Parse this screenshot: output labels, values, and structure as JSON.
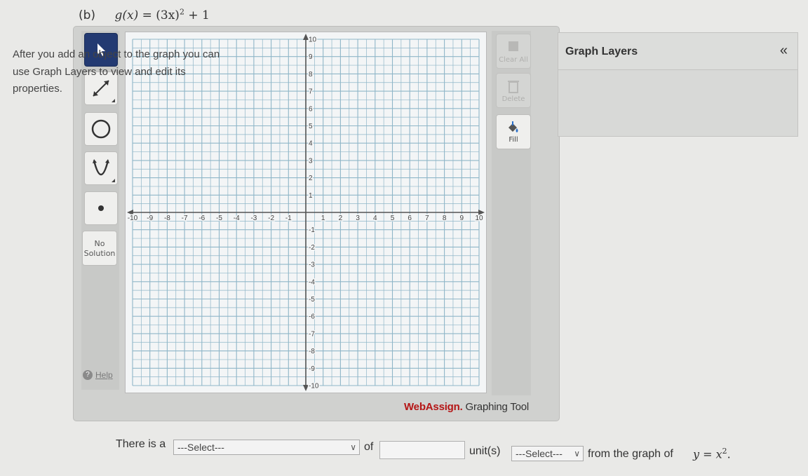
{
  "problem": {
    "part": "(b)",
    "func": "g(x)",
    "eq": "=",
    "base": "(3x)",
    "exp": "2",
    "tail": "+ 1"
  },
  "toolbar": {
    "tools": [
      {
        "name": "select-tool",
        "icon": "arrow-pointer-icon",
        "active": true
      },
      {
        "name": "line-tool",
        "icon": "line-segment-icon"
      },
      {
        "name": "circle-tool",
        "icon": "circle-icon"
      },
      {
        "name": "parabola-tool",
        "icon": "parabola-icon"
      },
      {
        "name": "point-tool",
        "icon": "point-icon"
      }
    ],
    "no_solution_line1": "No",
    "no_solution_line2": "Solution",
    "help_label": "Help"
  },
  "side_tools": {
    "clear_label": "Clear All",
    "delete_label": "Delete",
    "fill_label": "Fill"
  },
  "graph": {
    "x_min": -10,
    "x_max": 10,
    "y_min": -10,
    "y_max": 10,
    "x_ticks": [
      "-10",
      "-9",
      "-8",
      "-7",
      "-6",
      "-5",
      "-4",
      "-3",
      "-2",
      "-1",
      "1",
      "2",
      "3",
      "4",
      "5",
      "6",
      "7",
      "8",
      "9",
      "10"
    ],
    "y_ticks": [
      "10",
      "9",
      "8",
      "7",
      "6",
      "5",
      "4",
      "3",
      "2",
      "1",
      "-1",
      "-2",
      "-3",
      "-4",
      "-5",
      "-6",
      "-7",
      "-8",
      "-9",
      "-10"
    ],
    "grid_color": "#8fb6c8",
    "axis_color": "#555555"
  },
  "brand": {
    "webassign": "WebAssign.",
    "tool_name": "Graphing Tool"
  },
  "layers": {
    "title": "Graph Layers",
    "collapse_icon": "«",
    "body": "After you add an object to the graph you can use Graph Layers to view and edit its properties."
  },
  "answer": {
    "prefix": "There is a",
    "select1": "---Select---",
    "of": "of",
    "input_value": "",
    "units": "unit(s)",
    "select2": "---Select---",
    "suffix": "from the graph of",
    "y": "y",
    "eq": "=",
    "x": "x",
    "exp": "2",
    "period": "."
  }
}
